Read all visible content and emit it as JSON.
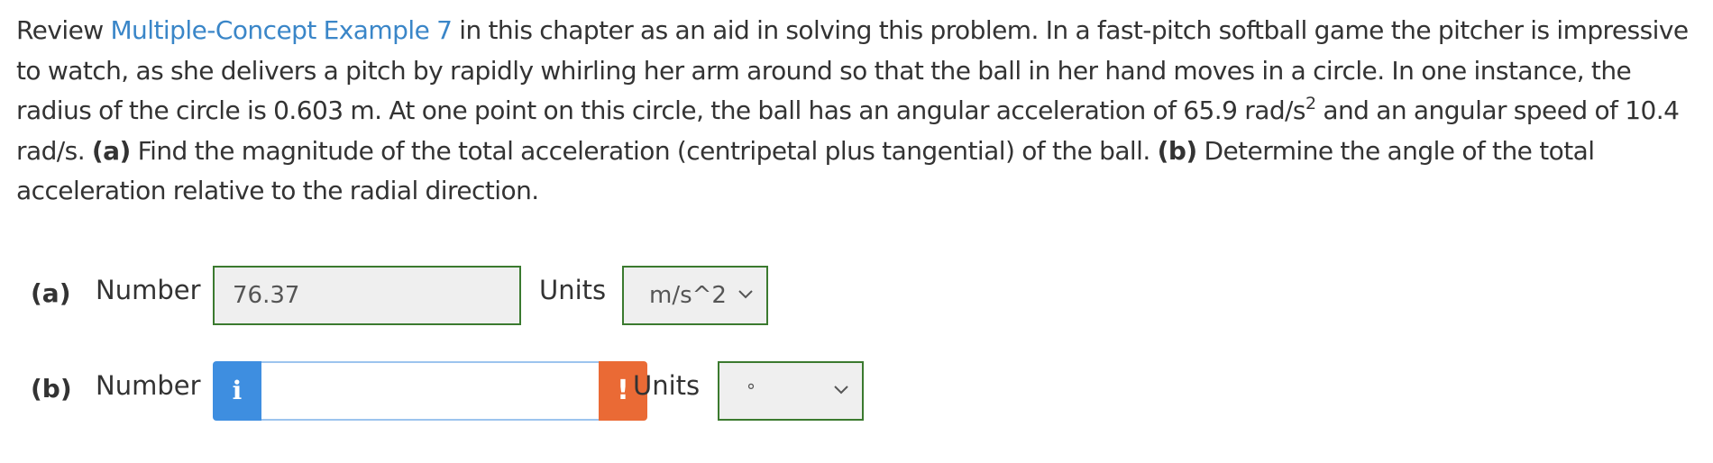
{
  "problem": {
    "review_prefix": "Review ",
    "link_text": "Multiple-Concept Example 7",
    "text_1": " in this chapter as an aid in solving this problem. In a fast-pitch softball game the pitcher is impressive to watch, as she delivers a pitch by rapidly whirling her arm around so that the ball in her hand moves in a circle. In one instance, the radius of the circle is 0.603 m. At one point on this circle, the ball has an angular acceleration of 65.9 rad/s",
    "superscript": "2",
    "text_2": " and an angular speed of 10.4 rad/s. ",
    "part_a_marker": "(a)",
    "part_a_text": " Find the magnitude of the total acceleration (centripetal plus tangential) of the ball. ",
    "part_b_marker": "(b)",
    "part_b_text": " Determine the angle of the total acceleration relative to the radial direction."
  },
  "answers": {
    "a": {
      "part_label": "(a)",
      "number_label": "Number",
      "value": "76.37",
      "units_label": "Units",
      "units_value": "m/s^2"
    },
    "b": {
      "part_label": "(b)",
      "number_label": "Number",
      "info_icon": "i",
      "value": "",
      "warning_icon": "!",
      "units_label": "Units",
      "units_value": "°"
    }
  },
  "colors": {
    "link": "#3a86c8",
    "valid_border": "#3b7a2f",
    "info_button": "#3e8ee0",
    "warning_button": "#ea6a35",
    "focus_border": "#9cc4ee"
  },
  "icons": {
    "info": "info-icon",
    "warning": "exclamation-icon",
    "select_arrow": "chevron-down-icon"
  }
}
